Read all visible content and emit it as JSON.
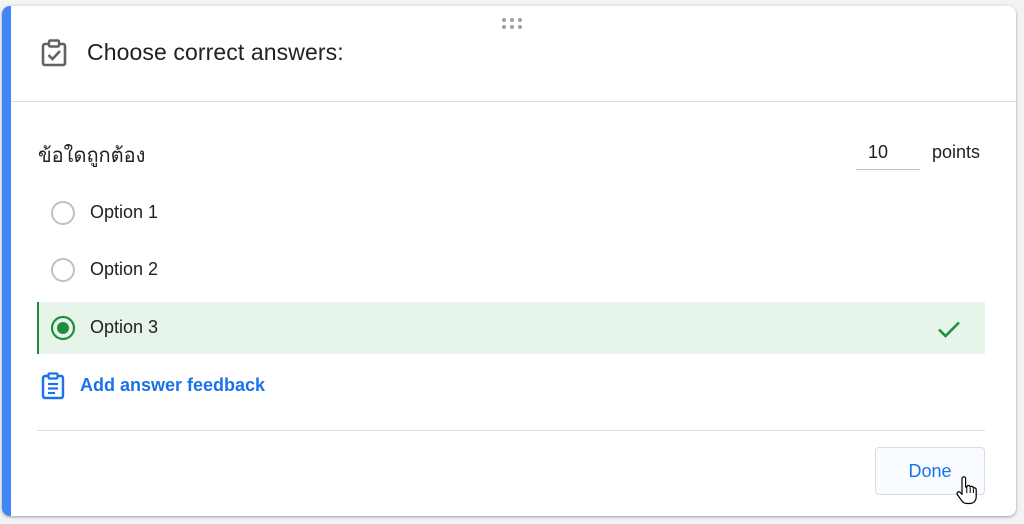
{
  "card": {
    "accent_color": "#4285f4",
    "header": {
      "icon": "checklist-icon",
      "title": "Choose correct answers:"
    },
    "question": "ข้อใดถูกต้อง",
    "points": {
      "value": "10",
      "label": "points"
    },
    "options": [
      {
        "label": "Option 1",
        "selected": false,
        "correct": false
      },
      {
        "label": "Option 2",
        "selected": false,
        "correct": false
      },
      {
        "label": "Option 3",
        "selected": true,
        "correct": true
      }
    ],
    "correct_color": "#1e8e3e",
    "correct_bg": "#e6f4ea",
    "feedback": {
      "icon": "clipboard-icon",
      "label": "Add answer feedback"
    },
    "done_button": "Done"
  }
}
